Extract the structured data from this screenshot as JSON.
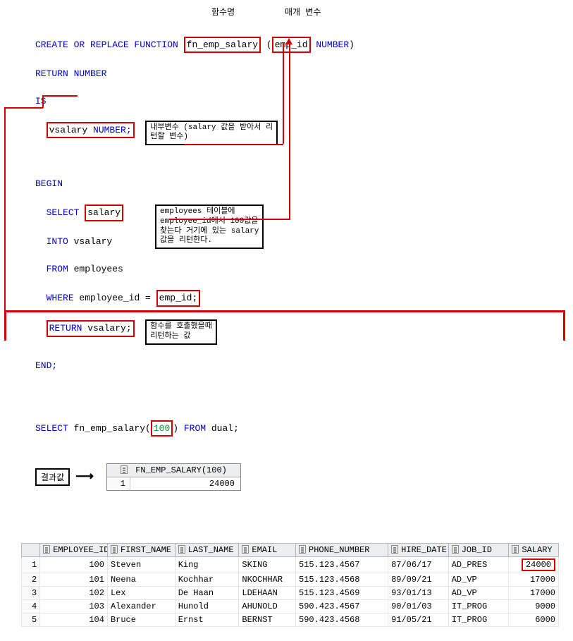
{
  "header_labels": {
    "func_name": "함수명",
    "param": "매개 변수"
  },
  "code": {
    "create": "CREATE OR REPLACE FUNCTION",
    "fn_name": "fn_emp_salary",
    "lpar": "(",
    "param": "emp_id",
    "param_type": " NUMBER",
    "rpar": ")",
    "return_number": "RETURN NUMBER",
    "is": "IS",
    "vsalary_decl_var": "vsalary ",
    "vsalary_decl_type": "NUMBER;",
    "intl_var_note_l1": "내부변수 (salary 값을 받아서 리",
    "intl_var_note_l2": "턴할 변수)",
    "begin": "BEGIN",
    "select": "SELECT",
    "salary": "salary",
    "into": "INTO",
    "vsalary_into": " vsalary",
    "from": "FROM",
    "employees_tbl": " employees",
    "where": "WHERE",
    "where_cond_pre": " employee_id = ",
    "where_cond_box": "emp_id;",
    "note2_l1": "employees 테이블에",
    "note2_l2": "employee_id에서 100값을",
    "note2_l3": "찾는다 거기에 있는 salary",
    "note2_l4": "값을 리턴한다.",
    "return": "RETURN",
    "vsalary_return": " vsalary;",
    "end": "END;",
    "note3_l1": "함수를 호출했을때",
    "note3_l2": "리턴하는 값",
    "call_select": "SELECT",
    "call_fn_pre": " fn_emp_salary(",
    "call_arg": "100",
    "call_fn_post": ") ",
    "from2": "FROM",
    "dual": " dual;"
  },
  "result_label": "결과값",
  "mini_grid": {
    "header": "FN_EMP_SALARY(100)",
    "row_idx": "1",
    "value": "24000"
  },
  "emp": {
    "headers": [
      "EMPLOYEE_ID",
      "FIRST_NAME",
      "LAST_NAME",
      "EMAIL",
      "PHONE_NUMBER",
      "HIRE_DATE",
      "JOB_ID",
      "SALARY"
    ],
    "rows": [
      {
        "idx": "1",
        "id": "100",
        "first": "Steven",
        "last": "King",
        "email": "SKING",
        "phone": "515.123.4567",
        "hire": "87/06/17",
        "job": "AD_PRES",
        "salary": "24000"
      },
      {
        "idx": "2",
        "id": "101",
        "first": "Neena",
        "last": "Kochhar",
        "email": "NKOCHHAR",
        "phone": "515.123.4568",
        "hire": "89/09/21",
        "job": "AD_VP",
        "salary": "17000"
      },
      {
        "idx": "3",
        "id": "102",
        "first": "Lex",
        "last": "De Haan",
        "email": "LDEHAAN",
        "phone": "515.123.4569",
        "hire": "93/01/13",
        "job": "AD_VP",
        "salary": "17000"
      },
      {
        "idx": "4",
        "id": "103",
        "first": "Alexander",
        "last": "Hunold",
        "email": "AHUNOLD",
        "phone": "590.423.4567",
        "hire": "90/01/03",
        "job": "IT_PROG",
        "salary": "9000"
      },
      {
        "idx": "5",
        "id": "104",
        "first": "Bruce",
        "last": "Ernst",
        "email": "BERNST",
        "phone": "590.423.4568",
        "hire": "91/05/21",
        "job": "IT_PROG",
        "salary": "6000"
      }
    ]
  }
}
